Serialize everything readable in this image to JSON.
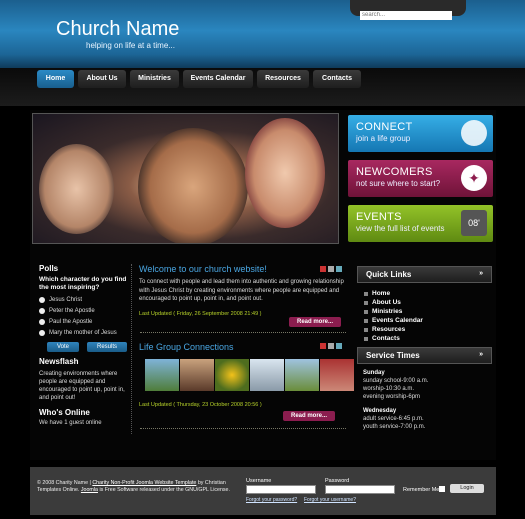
{
  "header": {
    "title": "Church Name",
    "tagline": "helping on life at a time..."
  },
  "search": {
    "placeholder": "search..."
  },
  "nav": {
    "items": [
      "Home",
      "About Us",
      "Ministries",
      "Events Calendar",
      "Resources",
      "Contacts"
    ]
  },
  "promos": [
    {
      "title": "CONNECT",
      "subtitle": "join a life group",
      "color": "#1a95d2"
    },
    {
      "title": "NEWCOMERS",
      "subtitle": "not sure where to start?",
      "color": "#8e1d4e"
    },
    {
      "title": "EVENTS",
      "subtitle": "view the full list of events",
      "color": "#7ba61d",
      "badge": "08'"
    }
  ],
  "polls": {
    "heading": "Polls",
    "question": "Which character do you find the most inspiring?",
    "options": [
      "Jesus Christ",
      "Peter the Apostle",
      "Paul the Apostle",
      "Mary the mother of Jesus"
    ],
    "vote_label": "Vote",
    "results_label": "Results"
  },
  "newsflash": {
    "heading": "Newsflash",
    "text": "Creating environments where people are equipped and encouraged to point up, point in, and point out!"
  },
  "online": {
    "heading": "Who's Online",
    "text": "We have 1 guest online"
  },
  "articles": [
    {
      "title": "Welcome to our church website!",
      "body": "To connect with people and lead them into authentic and growing relationship with Jesus Christ by creating environments where people are equipped and encouraged to point up, point in, and point out.",
      "updated": "Last Updated ( Friday, 26 September 2008 21:49 )",
      "readmore": "Read more..."
    },
    {
      "title": "Life Group Connections",
      "updated": "Last Updated ( Thursday, 23 October 2008 20:56 )",
      "readmore": "Read more..."
    }
  ],
  "quick_links": {
    "heading": "Quick Links",
    "items": [
      "Home",
      "About Us",
      "Ministries",
      "Events Calendar",
      "Resources",
      "Contacts"
    ]
  },
  "service_times": {
    "heading": "Service Times",
    "sunday_label": "Sunday",
    "sunday": [
      "sunday school-9:00 a.m.",
      "worship-10:30 a.m.",
      "evening worship-6pm"
    ],
    "wednesday_label": "Wednesday",
    "wednesday": [
      "adult service-6:45 p.m.",
      "youth service-7:00 p.m."
    ]
  },
  "footer": {
    "copyright": "© 2008 Charity Name |",
    "link1": "Charity Non-Profit Joomla Website Template",
    "text2": "by Christian Templates Online.",
    "link2": "Joomla",
    "text3": "is Free Software released under the GNU/GPL License.",
    "username_label": "Username",
    "password_label": "Password",
    "remember_label": "Remember Me",
    "login_label": "Login",
    "forgot_password": "Forgot your password?",
    "forgot_username": "Forgot your username?"
  }
}
